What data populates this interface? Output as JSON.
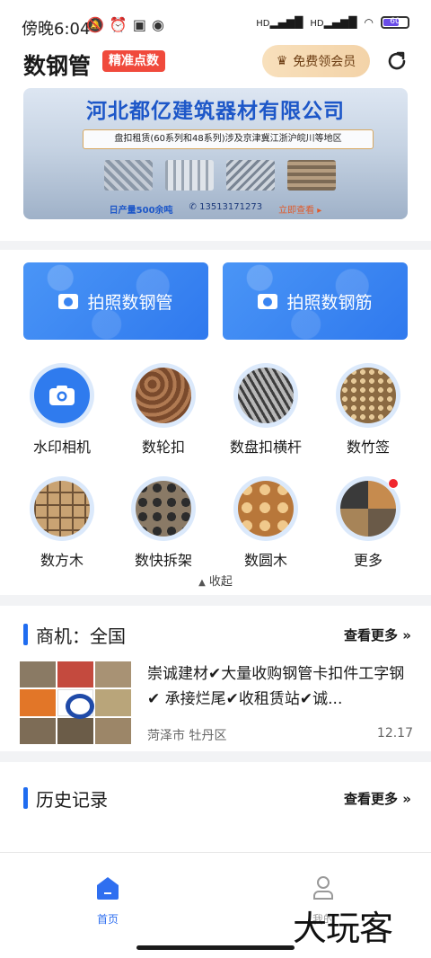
{
  "status_bar": {
    "time": "傍晚6:04",
    "network_1": "HD",
    "network_2": "HD",
    "battery": "60"
  },
  "header": {
    "title": "数钢管",
    "badge": "精准点数",
    "vip_label": "免费领会员"
  },
  "banner": {
    "company": "河北都亿建筑器材有限公司",
    "subtitle": "盘扣租赁(60系列和48系列)涉及京津冀江浙沪皖川等地区",
    "output": "日产量500余吨",
    "phone": "13513171273",
    "cta": "立即查看 ▸"
  },
  "big_buttons": [
    {
      "label": "拍照数钢管"
    },
    {
      "label": "拍照数钢筋"
    }
  ],
  "icons": [
    {
      "label": "水印相机"
    },
    {
      "label": "数轮扣"
    },
    {
      "label": "数盘扣横杆"
    },
    {
      "label": "数竹签"
    },
    {
      "label": "数方木"
    },
    {
      "label": "数快拆架"
    },
    {
      "label": "数圆木"
    },
    {
      "label": "更多"
    }
  ],
  "collapse_label": "收起",
  "business": {
    "title": "商机：全国",
    "more": "查看更多",
    "item": {
      "text": "崇诚建材✔大量收购钢管卡扣件工字钢✔ 承接烂尾✔收租赁站✔诚...",
      "location": "菏泽市 牡丹区",
      "date": "12.17"
    }
  },
  "history": {
    "title": "历史记录",
    "more": "查看更多"
  },
  "tabbar": {
    "home": "首页",
    "mine": "我的"
  },
  "watermark": "大玩客",
  "colors": {
    "primary": "#1f6cf0",
    "badge": "#f04a3c",
    "vip_bg": "#f6dab2"
  }
}
